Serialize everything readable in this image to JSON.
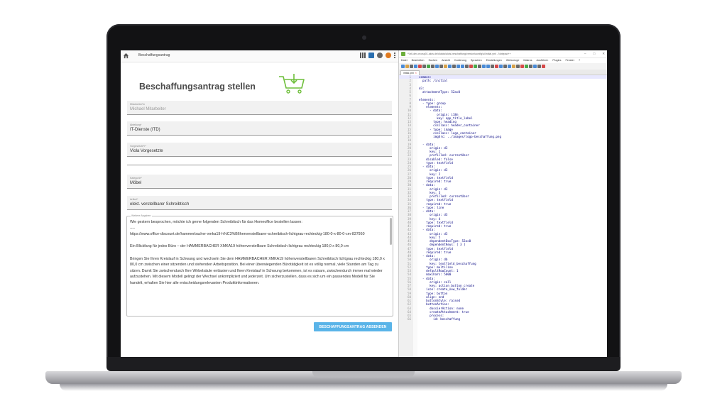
{
  "webapp": {
    "app_title": "Beschaffungsantrag",
    "page_title": "Beschaffungsantrag stellen",
    "fields": [
      {
        "label": "Mitarbeiter*in",
        "value": "Michael Mitarbeiter",
        "disabled": true
      },
      {
        "label": "Abteilung*",
        "value": "IT-Dienste (ITD)",
        "disabled": false
      },
      {
        "label": "Vorgesetzte*r*",
        "value": "Viola Vorgesetzte",
        "disabled": false
      },
      {
        "label": "Kategorie*",
        "value": "Möbel",
        "disabled": false
      },
      {
        "label": "Artikel*",
        "value": "elekt. verstellbarer Schreibtisch",
        "disabled": false
      }
    ],
    "textarea_label": "Weitere Angaben",
    "textarea_value": "Wie gestern besprochen, möchte ich gerne folgenden Schreibtisch für das Homeoffice bestellen lassen:\n----\nhttps://www.office-discount.de/hammerbacher-xmka19-h%C3%B6henverstellbarer-schreibtisch-lichtgrau-rechteckig-180-0-x-80-0-cm-837950\n\nEin Blickfang für jedes Büro – der HAMMERBACHER XMKA19 höhenverstellbare Schreibtisch lichtgrau rechteckig 180,0 x 80,0 cm\n\nBringen Sie Ihren Kreislauf in Schwung und wechseln Sie dem HAMMERBACHER XMKA19 höhenverstellbaren Schreibtisch lichtgrau rechteckig 180,0 x 80,0 cm zwischen einer sitzenden und stehenden Arbeitsposition. Bei einer überwiegenden Bürotätigkeit ist es völlig normal, viele Stunden am Tag zu sitzen. Damit Sie zwischendurch Ihre Wirbelsäule entlasten und Ihren Kreislauf in Schwung bekommen, ist es ratsam, zwischendurch immer mal wieder aufzustehen. Mit diesem Modell gelingt der Wechsel unkompliziert und jederzeit. Um sicherzustellen, dass es sich um ein passendes Modell für Sie handelt, erhalten Sie hier alle entscheidungsrelevanten Produktinformationen.",
    "submit_label": "BESCHAFFUNGSANTRAG ABSENDEN",
    "accent_color": "#5ab4e8"
  },
  "editor": {
    "window_title": "*\\\\ell-dev-ecosp01.alcis.de\\d\\alcis\\alcis-beschaffung\\version\\config\\ui\\initial.yml - Notepad++",
    "window_controls": [
      "–",
      "□",
      "✕"
    ],
    "menu": [
      "Datei",
      "Bearbeiten",
      "Suchen",
      "Ansicht",
      "Kodierung",
      "Sprachen",
      "Einstellungen",
      "Werkzeuge",
      "Makros",
      "Ausführen",
      "Plugins",
      "Fenster",
      "?"
    ],
    "tab_label": "initial.yml",
    "lines": [
      "common:",
      "  path: /initial",
      "",
      "d3:",
      "  attachmentType: 52ac0",
      "",
      "elements:",
      "  - type: group",
      "    elements:",
      "      - data:",
      "          origin: i18n",
      "          key: app_title_label",
      "        type: heading",
      "        cssClass: header_container",
      "      - type: image",
      "        cssClass: logo_container",
      "        imgSrc: ../images/logo-beschaffung.png",
      "",
      "  - data:",
      "      origin: d3",
      "      key: 1",
      "      prefilled: currentUser",
      "    disabled: false",
      "    type: textfield",
      "  - data:",
      "      origin: d3",
      "      key: 2",
      "    type: textfield",
      "    required: true",
      "  - data:",
      "      origin: d3",
      "      key: 3",
      "      prefilled: currentUser",
      "    type: textfield",
      "    required: true",
      "  - type: line",
      "  - data:",
      "      origin: d3",
      "      key: 4",
      "    type: textfield",
      "    required: true",
      "  - data:",
      "      origin: d3",
      "      key: 5",
      "      dependentDocType: 52ac0",
      "      dependentKeys: [ 3 ]",
      "    type: textfield",
      "    required: true",
      "  - data:",
      "      origin: db",
      "      key: textfield_beschaffung",
      "    type: multiline",
      "    defaultRowCount: 1",
      "    maxChars: 5000",
      "  - data:",
      "      origin: call",
      "      key: action_button_create",
      "    icon: create_new_folder",
      "    type: button",
      "    align: end",
      "    buttonStyle: raised",
      "    buttonAction:",
      "      dossierAction: none",
      "      createAttachment: true",
      "      process:",
      "        id: beschaffung"
    ]
  }
}
